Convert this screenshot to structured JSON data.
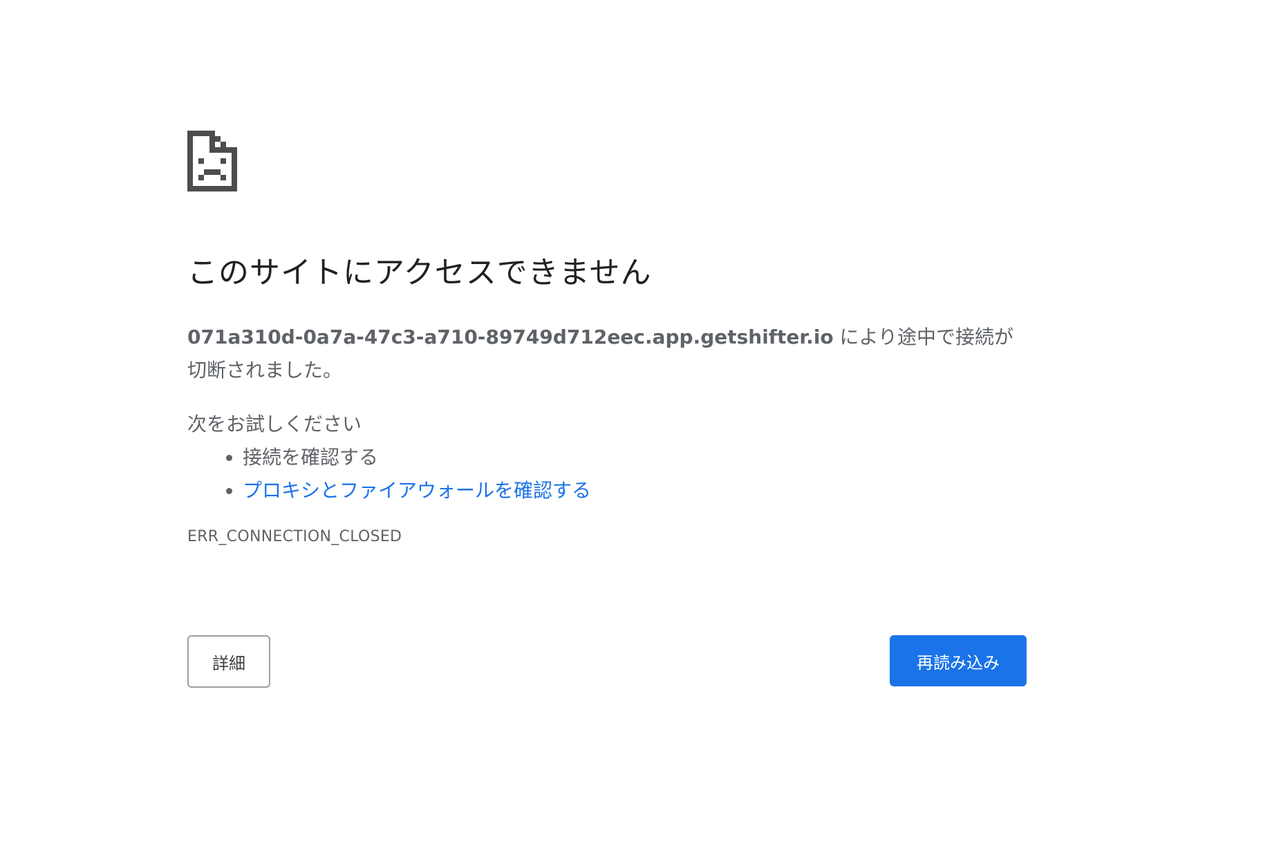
{
  "error_icon": {
    "name": "sad-page-icon",
    "color": "#4d4d4d"
  },
  "title": "このサイトにアクセスできません",
  "message": {
    "host": "071a310d-0a7a-47c3-a710-89749d712eec.app.getshifter.io",
    "text": " により途中で接続が切断されました。"
  },
  "suggestions": {
    "heading": "次をお試しください",
    "items": [
      {
        "label": "接続を確認する",
        "is_link": false
      },
      {
        "label": "プロキシとファイアウォールを確認する",
        "is_link": true
      }
    ]
  },
  "error_code": "ERR_CONNECTION_CLOSED",
  "buttons": {
    "details_label": "詳細",
    "reload_label": "再読み込み"
  },
  "colors": {
    "link": "#1a73e8",
    "primary_button": "#1a73e8",
    "secondary_text": "#5f6368"
  }
}
